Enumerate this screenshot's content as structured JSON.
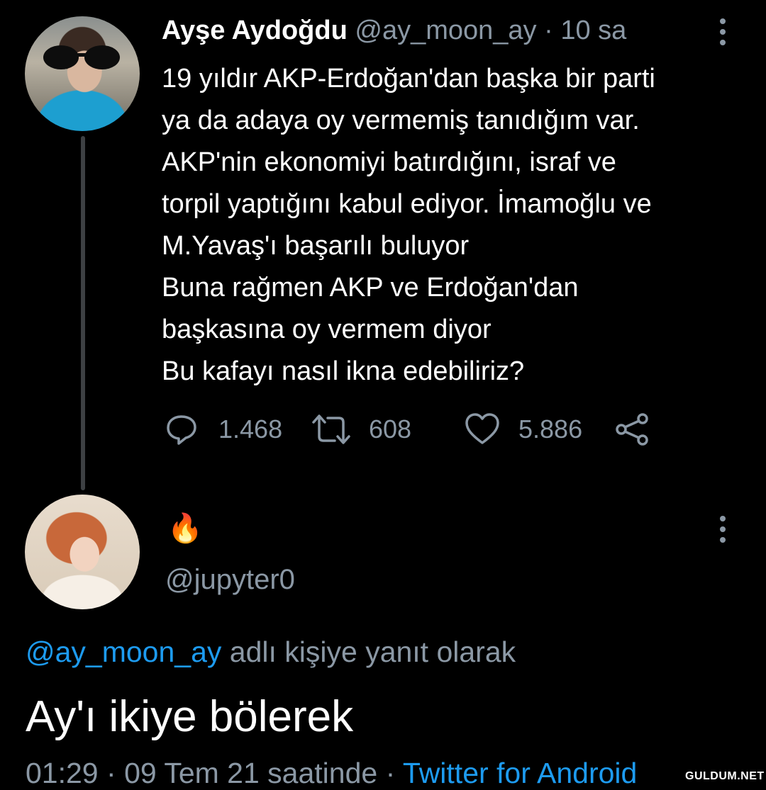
{
  "tweet": {
    "author_name": "Ayşe Aydoğdu",
    "handle": "@ay_moon_ay",
    "separator": "·",
    "time_ago": "10 sa",
    "text_lines": [
      "19 yıldır AKP-Erdoğan'dan başka bir parti",
      "ya da adaya oy vermemiş tanıdığım var.",
      "AKP'nin ekonomiyi batırdığını, israf ve",
      "torpil yaptığını kabul ediyor. İmamoğlu ve",
      "M.Yavaş'ı başarılı buluyor",
      "Buna rağmen AKP ve Erdoğan'dan",
      "başkasına oy vermem diyor",
      "Bu kafayı nasıl ikna edebiliriz?"
    ],
    "actions": {
      "reply_count": "1.468",
      "retweet_count": "608",
      "like_count": "5.886"
    },
    "icons": {
      "reply": "reply-bubble-icon",
      "retweet": "retweet-icon",
      "like": "heart-icon",
      "share": "share-icon",
      "more": "more-vertical-icon"
    }
  },
  "reply": {
    "display_name_emoji": "🔥",
    "handle": "@jupyter0",
    "reply_to_handle": "@ay_moon_ay",
    "reply_to_suffix": " adlı kişiye yanıt olarak",
    "text": "Ay'ı ikiye bölerek",
    "timestamp_time": "01:29",
    "timestamp_date": "09 Tem 21 saatinde",
    "separator": "·",
    "source": "Twitter for Android"
  },
  "watermark": "GULDUM.NET",
  "colors": {
    "background": "#000000",
    "text": "#ffffff",
    "muted": "#8b98a5",
    "link": "#1d9bf0",
    "thread_line": "#3d4043"
  }
}
